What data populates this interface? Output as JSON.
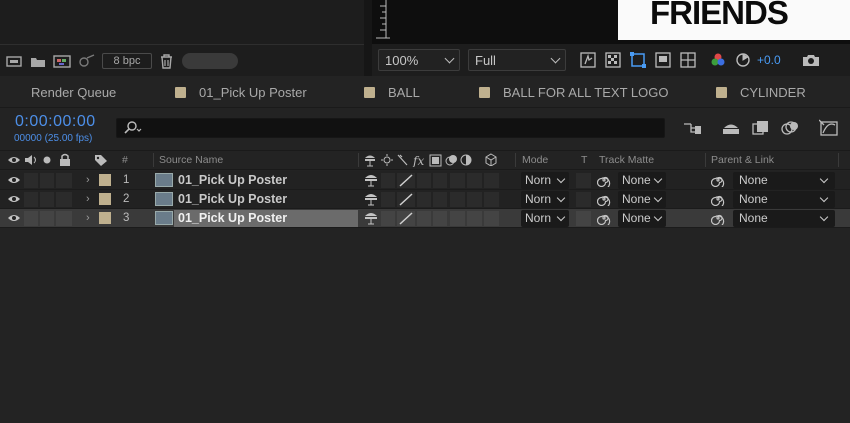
{
  "project_panel": {
    "bit_depth": "8 bpc"
  },
  "composition_preview": {
    "text": "FRIENDS"
  },
  "viewer_toolbar": {
    "zoom": "100%",
    "resolution": "Full",
    "exposure": "+0.0"
  },
  "tabs": [
    {
      "label": "Render Queue",
      "has_swatch": false
    },
    {
      "label": "01_Pick Up Poster",
      "has_swatch": true,
      "swatch_color": "#bfb08e"
    },
    {
      "label": "BALL",
      "has_swatch": true,
      "swatch_color": "#bfb08e"
    },
    {
      "label": "BALL FOR ALL TEXT LOGO",
      "has_swatch": true,
      "swatch_color": "#bfb08e"
    },
    {
      "label": "CYLINDER",
      "has_swatch": true,
      "swatch_color": "#bfb08e"
    }
  ],
  "timeline": {
    "timecode": "0:00:00:00",
    "frame_fps": "00000 (25.00 fps)",
    "search_placeholder": ""
  },
  "columns": {
    "hash": "#",
    "source_name": "Source Name",
    "mode": "Mode",
    "t": "T",
    "track_matte": "Track Matte",
    "parent_link": "Parent & Link"
  },
  "layers": [
    {
      "number": "1",
      "name": "01_Pick Up Poster",
      "mode": "Norn",
      "track_matte": "None",
      "parent": "None",
      "selected": false
    },
    {
      "number": "2",
      "name": "01_Pick Up Poster",
      "mode": "Norn",
      "track_matte": "None",
      "parent": "None",
      "selected": false
    },
    {
      "number": "3",
      "name": "01_Pick Up Poster",
      "mode": "Norn",
      "track_matte": "None",
      "parent": "None",
      "selected": true
    }
  ],
  "colors": {
    "accent_blue": "#4d8fe8",
    "label_swatch": "#bfb08e",
    "panel_bg": "#232323"
  }
}
